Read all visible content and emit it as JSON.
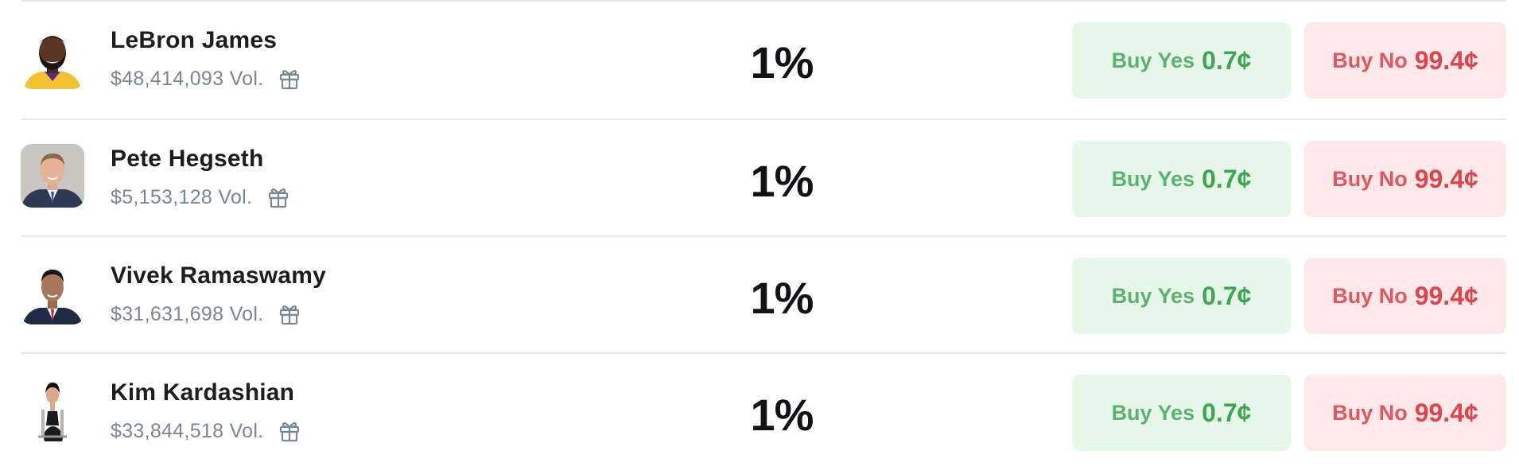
{
  "rows": [
    {
      "name": "LeBron James",
      "volume": "$48,414,093 Vol.",
      "percent": "1%",
      "yes_label": "Buy Yes",
      "yes_price": "0.7¢",
      "no_label": "Buy No",
      "no_price": "99.4¢",
      "avatar_icon": "lebron-james-photo"
    },
    {
      "name": "Pete Hegseth",
      "volume": "$5,153,128 Vol.",
      "percent": "1%",
      "yes_label": "Buy Yes",
      "yes_price": "0.7¢",
      "no_label": "Buy No",
      "no_price": "99.4¢",
      "avatar_icon": "pete-hegseth-photo"
    },
    {
      "name": "Vivek Ramaswamy",
      "volume": "$31,631,698 Vol.",
      "percent": "1%",
      "yes_label": "Buy Yes",
      "yes_price": "0.7¢",
      "no_label": "Buy No",
      "no_price": "99.4¢",
      "avatar_icon": "vivek-ramaswamy-photo"
    },
    {
      "name": "Kim Kardashian",
      "volume": "$33,844,518 Vol.",
      "percent": "1%",
      "yes_label": "Buy Yes",
      "yes_price": "0.7¢",
      "no_label": "Buy No",
      "no_price": "99.4¢",
      "avatar_icon": "kim-kardashian-photo"
    }
  ],
  "icons": {
    "volume_reward": "gift-icon"
  },
  "colors": {
    "yes_bg": "#e6f6e9",
    "yes_text": "#3ea653",
    "no_bg": "#fde9ea",
    "no_text": "#e0434c",
    "muted_text": "#7b8794",
    "divider": "#e6e8eb"
  }
}
